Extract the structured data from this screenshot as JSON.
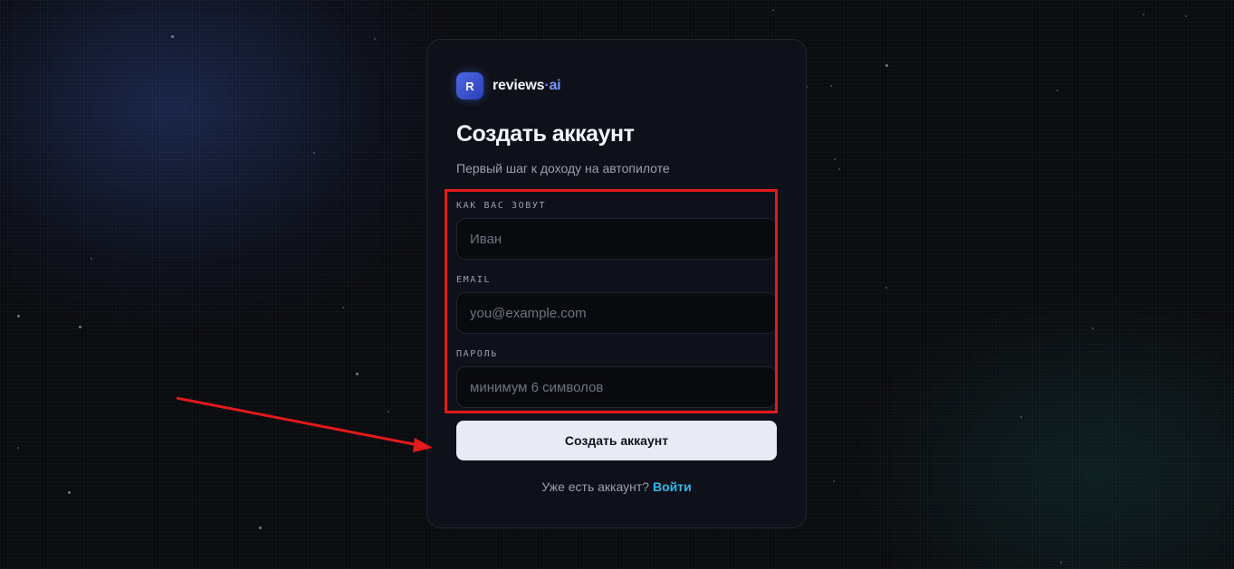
{
  "brand": {
    "badge_letter": "R",
    "name_main": "reviews",
    "name_dot": "·",
    "name_suffix": "ai",
    "accent_color": "#4d68e8"
  },
  "page": {
    "title": "Создать аккаунт",
    "subtitle": "Первый шаг к доходу на автопилоте"
  },
  "form": {
    "name": {
      "label": "КАК ВАС ЗОВУТ",
      "placeholder": "Иван",
      "value": ""
    },
    "email": {
      "label": "EMAIL",
      "placeholder": "you@example.com",
      "value": ""
    },
    "password": {
      "label": "ПАРОЛЬ",
      "placeholder": "минимум 6 символов",
      "value": ""
    },
    "submit_label": "Создать аккаунт"
  },
  "footer": {
    "prompt": "Уже есть аккаунт?",
    "link_label": "Войти",
    "link_color": "#31b6ec"
  },
  "annotation": {
    "highlight_color": "#e11a1a"
  }
}
